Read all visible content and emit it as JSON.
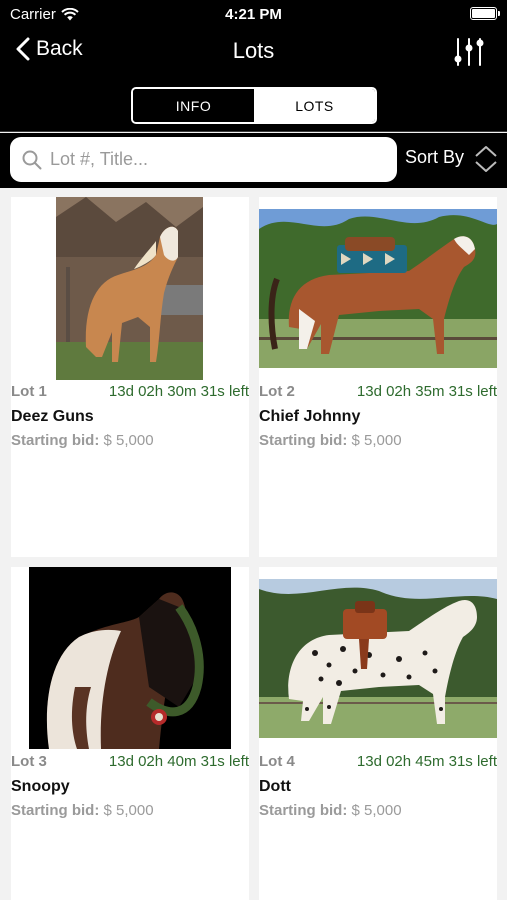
{
  "status_bar": {
    "carrier": "Carrier",
    "time": "4:21 PM"
  },
  "nav": {
    "back_label": "Back",
    "title": "Lots"
  },
  "segments": {
    "info": "INFO",
    "lots": "LOTS",
    "active": "LOTS"
  },
  "search": {
    "placeholder": "Lot #, Title...",
    "value": "",
    "sort_label": "Sort By"
  },
  "lots": [
    {
      "lot_label": "Lot 1",
      "time_left": "13d 02h 30m 31s left",
      "title": "Deez Guns",
      "bid_label": "Starting bid:",
      "bid_value": "$ 5,000"
    },
    {
      "lot_label": "Lot 2",
      "time_left": "13d 02h 35m 31s left",
      "title": "Chief Johnny",
      "bid_label": "Starting bid:",
      "bid_value": "$ 5,000"
    },
    {
      "lot_label": "Lot 3",
      "time_left": "13d 02h 40m 31s left",
      "title": "Snoopy",
      "bid_label": "Starting bid:",
      "bid_value": "$ 5,000"
    },
    {
      "lot_label": "Lot 4",
      "time_left": "13d 02h 45m 31s left",
      "title": "Dott",
      "bid_label": "Starting bid:",
      "bid_value": "$ 5,000"
    }
  ],
  "colors": {
    "bar": "#000000",
    "time_left": "#2e6b2e",
    "muted": "#9a9a9a"
  }
}
